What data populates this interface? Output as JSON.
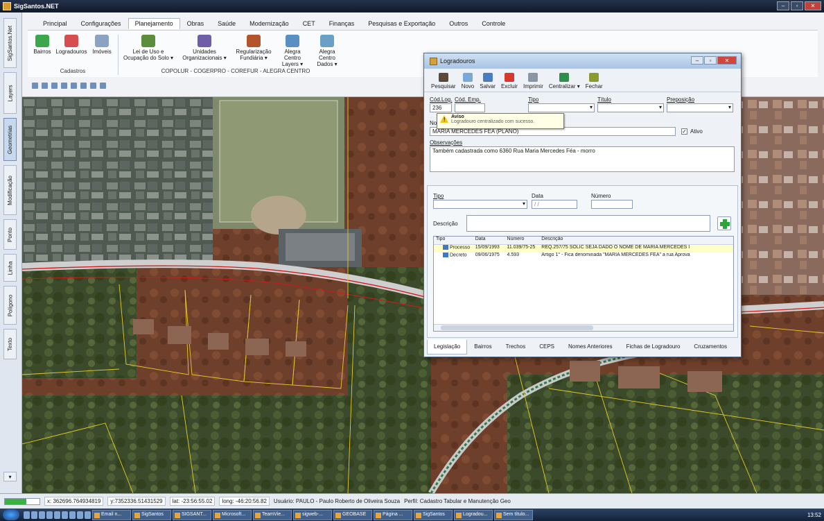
{
  "app": {
    "title": "SigSantos.NET"
  },
  "window_buttons": [
    "–",
    "▫",
    "✕"
  ],
  "colors": {
    "accent": "#3cb043",
    "road": "#d11a1a",
    "parcel": "#e6cc2a",
    "dialog_title": "#a9c4e4"
  },
  "ribbon": {
    "tabs": [
      "Principal",
      "Configurações",
      "Planejamento",
      "Obras",
      "Saúde",
      "Modernização",
      "CET",
      "Finanças",
      "Pesquisas e Exportação",
      "Outros",
      "Controle"
    ],
    "active_tab": "Planejamento",
    "cadastros": {
      "label": "Cadastros",
      "buttons": [
        {
          "label": "Bairros",
          "icon": "bairros-icon",
          "color": "#3aa84a"
        },
        {
          "label": "Logradouros",
          "icon": "logradouros-icon",
          "color": "#d84e4e"
        },
        {
          "label": "Imóveis",
          "icon": "imoveis-icon",
          "color": "#8aa3c4"
        }
      ]
    },
    "copolur": {
      "label": "COPOLUR - COGERPRO - COREFUR - ALEGRA CENTRO",
      "buttons": [
        {
          "label": "Lei de Uso e Ocupação do Solo ▾",
          "icon": "lei-uso-icon",
          "color": "#5d8c3c"
        },
        {
          "label": "Unidades Organizacionais ▾",
          "icon": "unidades-icon",
          "color": "#6f5fa8"
        },
        {
          "label": "Regularização Fundiária ▾",
          "icon": "regularizacao-icon",
          "color": "#b2542c"
        },
        {
          "label": "Alegra Centro Layers ▾",
          "icon": "alegra-layers-icon",
          "color": "#5a8fc4"
        },
        {
          "label": "Alegra Centro Dados ▾",
          "icon": "alegra-dados-icon",
          "color": "#6aa0c8"
        }
      ]
    }
  },
  "sidebar_tabs": [
    "SigSantos.Net",
    "Layers",
    "Geometrias",
    "Modificação",
    "Ponto",
    "Linha",
    "Polígono",
    "Texto"
  ],
  "sidebar_active": "Geometrias",
  "dialog": {
    "title": "Logradouros",
    "toolbar": [
      {
        "label": "Pesquisar",
        "icon": "binoculars-icon",
        "color": "#5b4a3a"
      },
      {
        "label": "Novo",
        "icon": "new-document-icon",
        "color": "#7aa8d8"
      },
      {
        "label": "Salvar",
        "icon": "save-icon",
        "color": "#4a7cc0"
      },
      {
        "label": "Excluir",
        "icon": "delete-icon",
        "color": "#d9382f"
      },
      {
        "label": "Imprimir",
        "icon": "print-icon",
        "color": "#8b95a3"
      },
      {
        "label": "Centralizar ▾",
        "icon": "globe-icon",
        "color": "#2f8f4a"
      },
      {
        "label": "Fechar",
        "icon": "close-door-icon",
        "color": "#8c9a2f"
      }
    ],
    "labels": {
      "cod_log": "Cód.Log.",
      "cod_emp": "Cód. Emp.",
      "tipo": "Tipo",
      "titulo": "Título",
      "preposicao": "Preposição",
      "nome": "Nome",
      "ativo": "Ativo",
      "observacoes": "Observações"
    },
    "values": {
      "cod_log": "236",
      "nome": "MARIA MERCEDES FEA (PLANO)",
      "observacoes": "Também cadastrada como 6360 Rua Maria Mercedes Féa - morro",
      "ativo": "✓"
    },
    "tooltip": {
      "title": "Aviso",
      "message": "Logradouro centralizado com sucesso."
    },
    "legislacao": {
      "labels": {
        "tipo": "Tipo",
        "data": "Data",
        "numero": "Número",
        "descricao": "Descrição"
      },
      "data_placeholder": "/ /",
      "columns": [
        "Tipo",
        "Data",
        "Número",
        "Descrição"
      ],
      "rows": [
        {
          "tipo": "Processo",
          "data": "15/09/1993",
          "numero": "11.039/75-25",
          "descricao": "REQ.257/75 SOLIC SEJA DADO O NOME DE MARIA MERCEDES I"
        },
        {
          "tipo": "Decreto",
          "data": "09/06/1975",
          "numero": "4.593",
          "descricao": "Artigo 1° - Fica denominada \"MARIA MERCEDES FEA\" a rua Aprova"
        }
      ]
    },
    "tabs": [
      "Legislação",
      "Bairros",
      "Trechos",
      "CEPS",
      "Nomes Anteriores",
      "Fichas de Logradouro",
      "Cruzamentos"
    ],
    "active_tab": "Legislação"
  },
  "status": {
    "progress": 0.62,
    "x": "x: 362696.764934819",
    "y": "y:7352336.51431529",
    "lat": "lat: -23:56:55.02",
    "long": "long: -46:20:56.82",
    "user": "Usuário: PAULO - Paulo Roberto de Oliveira Souza",
    "profile": "Perfil: Cadastro Tabular e Manutenção Geo"
  },
  "taskbar": {
    "tasks": [
      "Email n...",
      "SigSantos",
      "SIGSANT...",
      "Microsoft...",
      "TeamVie...",
      "sigweb-...",
      "GEOBASE",
      "Página ...",
      "SigSantos",
      "Logradou...",
      "Sem título..."
    ],
    "tray": "13:52"
  }
}
